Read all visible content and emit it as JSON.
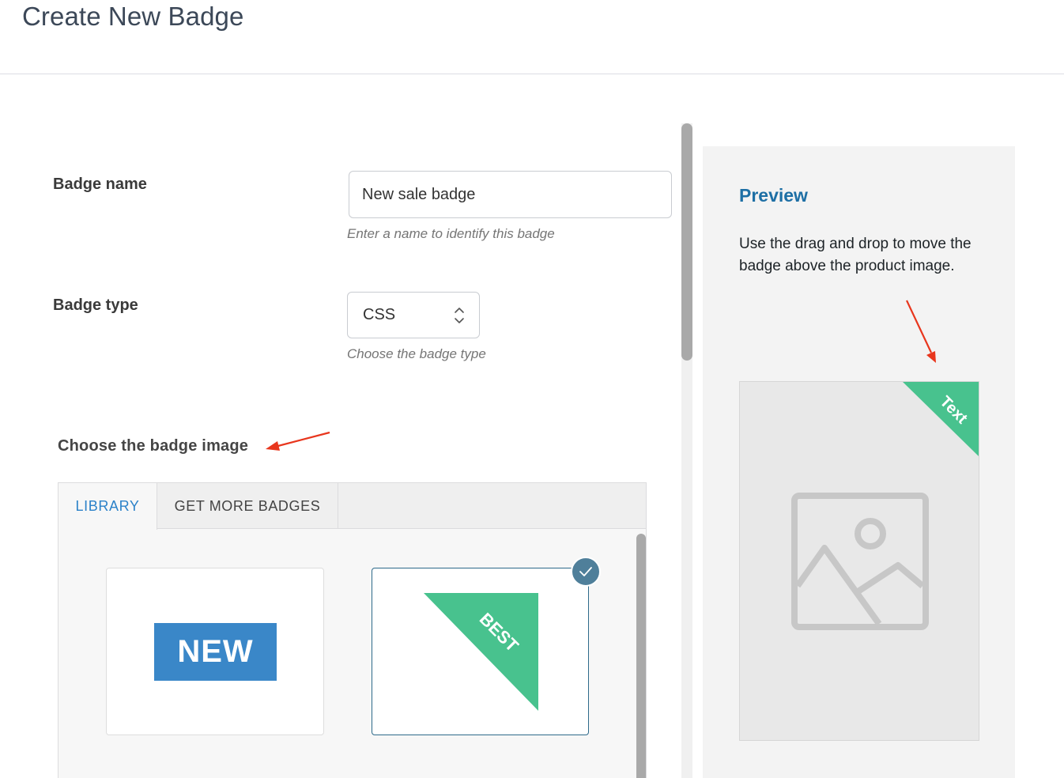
{
  "page": {
    "title": "Create New Badge"
  },
  "form": {
    "badge_name": {
      "label": "Badge name",
      "value": "New sale badge",
      "help": "Enter a name to identify this badge"
    },
    "badge_type": {
      "label": "Badge type",
      "value": "CSS",
      "help": "Choose the badge type"
    }
  },
  "badge_image": {
    "heading": "Choose the badge image",
    "tabs": [
      {
        "label": "LIBRARY",
        "active": true
      },
      {
        "label": "GET MORE BADGES",
        "active": false
      }
    ],
    "library": [
      {
        "text": "NEW",
        "color": "#3a87c8",
        "selected": false
      },
      {
        "text": "BEST",
        "color": "#48c28e",
        "selected": true
      }
    ]
  },
  "preview": {
    "title": "Preview",
    "description": "Use the drag and drop to move the badge above the product image.",
    "badge_text": "Text",
    "badge_color": "#48c28e",
    "placeholder_icon": "image-placeholder-icon"
  },
  "colors": {
    "accent": "#2c82c9",
    "badge_green": "#48c28e",
    "annotation_arrow": "#e8361d"
  }
}
